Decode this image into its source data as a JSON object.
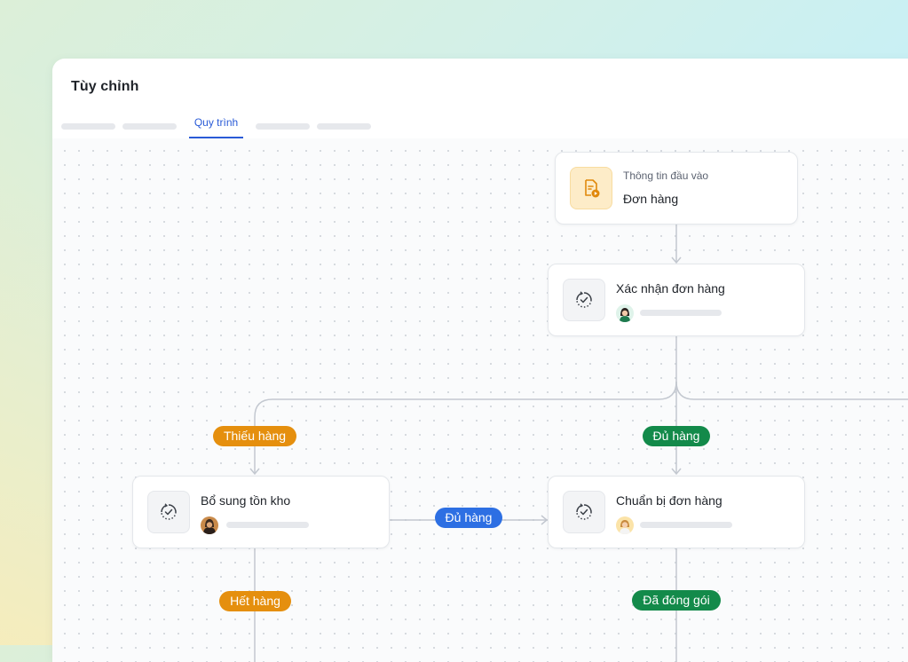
{
  "app": {
    "title": "Tùy chỉnh"
  },
  "tabs": {
    "active_label": "Quy trình"
  },
  "nodes": {
    "input": {
      "subtitle": "Thông tin đầu vào",
      "title": "Đơn hàng",
      "icon": "document-play-icon"
    },
    "confirm": {
      "title": "Xác nhận đơn hàng",
      "icon": "sync-check-icon"
    },
    "restock": {
      "title": "Bổ sung tồn kho",
      "icon": "sync-check-icon"
    },
    "prepare": {
      "title": "Chuẩn bị đơn hàng",
      "icon": "sync-check-icon"
    }
  },
  "labels": {
    "shortage": "Thiếu hàng",
    "enough_right": "Đủ hàng",
    "enough_mid": "Đủ hàng",
    "out_of_stock": "Hết hàng",
    "packed": "Đã đóng gói"
  },
  "colors": {
    "accent": "#2a5bd7",
    "orange_label": "#e58f0e",
    "green_label": "#138a4a",
    "blue_label": "#2d6fe3"
  }
}
